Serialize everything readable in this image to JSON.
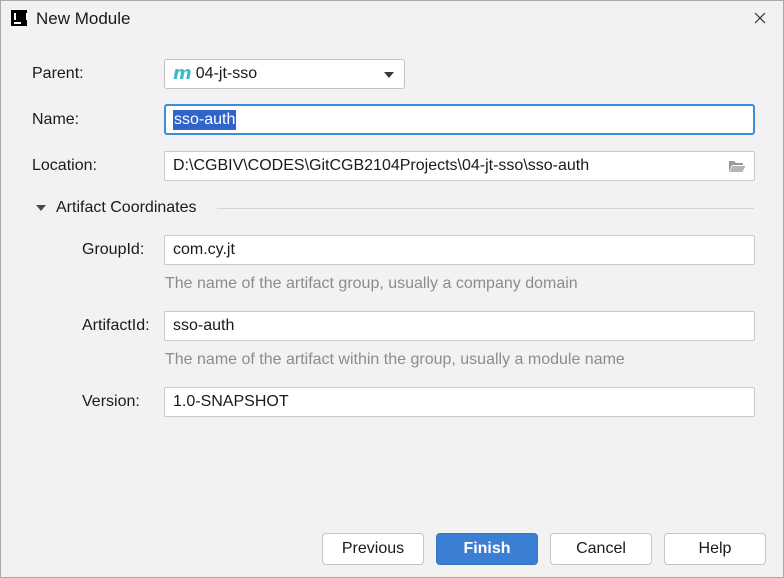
{
  "window": {
    "title": "New Module",
    "app_icon": "intellij-idea-icon"
  },
  "form": {
    "parent": {
      "label": "Parent:",
      "value": "04-jt-sso",
      "icon": "maven-module-icon"
    },
    "name": {
      "label": "Name:",
      "value": "sso-auth"
    },
    "location": {
      "label": "Location:",
      "value": "D:\\CGBIV\\CODES\\GitCGB2104Projects\\04-jt-sso\\sso-auth"
    }
  },
  "artifact": {
    "section_label": "Artifact Coordinates",
    "group_id": {
      "label": "GroupId:",
      "value": "com.cy.jt",
      "hint": "The name of the artifact group, usually a company domain"
    },
    "artifact_id": {
      "label": "ArtifactId:",
      "value": "sso-auth",
      "hint": "The name of the artifact within the group, usually a module name"
    },
    "version": {
      "label": "Version:",
      "value": "1.0-SNAPSHOT"
    }
  },
  "buttons": {
    "previous": "Previous",
    "finish": "Finish",
    "cancel": "Cancel",
    "help": "Help"
  },
  "colors": {
    "accent": "#3b7fd4",
    "selection": "#2f65ca",
    "focus_border": "#3d8ddb",
    "maven_icon": "#3fb8c9"
  }
}
